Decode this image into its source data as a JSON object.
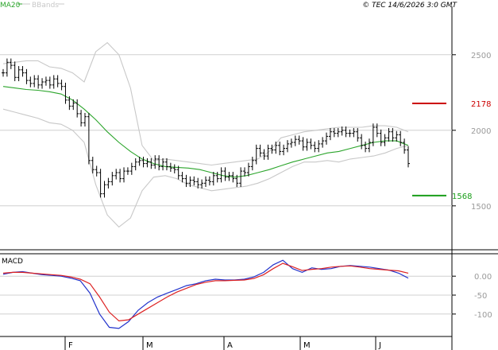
{
  "header": {
    "legend_ma": "MA20",
    "legend_bb": "BBands",
    "timestamp": "© TEC 14/6/2026 3:0 GMT"
  },
  "colors": {
    "ma": "#2ca52c",
    "bbands": "#c8c8c8",
    "price_bars": "#000000",
    "resistance": "#cc0000",
    "support": "#1a9e1a",
    "macd": "#2233cc",
    "signal": "#dd2222",
    "grid": "#d0d0d0",
    "axis_text": "#9a9a9a"
  },
  "chart_data": [
    {
      "type": "line",
      "title": "",
      "x": [
        "F",
        "M",
        "A",
        "M",
        "J"
      ],
      "ylim": [
        1220,
        2820
      ],
      "yticks": [
        "2500",
        "2000",
        "1500"
      ],
      "grid": true,
      "legend": [
        "MA20",
        "BBands"
      ],
      "levels": {
        "resistance": 2178,
        "support": 1568
      },
      "price_points": [
        2380,
        2450,
        2430,
        2350,
        2400,
        2380,
        2330,
        2310,
        2340,
        2300,
        2320,
        2330,
        2300,
        2340,
        2310,
        2290,
        2200,
        2160,
        2180,
        2110,
        2050,
        2090,
        1800,
        1740,
        1720,
        1580,
        1640,
        1660,
        1700,
        1720,
        1680,
        1730,
        1730,
        1760,
        1790,
        1800,
        1780,
        1790,
        1770,
        1810,
        1760,
        1790,
        1760,
        1750,
        1740,
        1700,
        1680,
        1650,
        1670,
        1660,
        1640,
        1650,
        1670,
        1660,
        1700,
        1680,
        1730,
        1690,
        1700,
        1680,
        1650,
        1730,
        1720,
        1760,
        1800,
        1880,
        1850,
        1830,
        1880,
        1870,
        1900,
        1860,
        1880,
        1910,
        1920,
        1940,
        1930,
        1890,
        1920,
        1900,
        1880,
        1910,
        1930,
        1960,
        1990,
        1980,
        1990,
        2000,
        1980,
        1980,
        1990,
        1950,
        1900,
        1880,
        1920,
        2020,
        1980,
        1920,
        1950,
        1990,
        1950,
        1970,
        1920,
        1870,
        1780
      ],
      "series": [
        {
          "name": "MA20",
          "values": [
            2290,
            2280,
            2270,
            2265,
            2255,
            2240,
            2200,
            2140,
            2070,
            1990,
            1920,
            1860,
            1810,
            1780,
            1760,
            1755,
            1750,
            1740,
            1720,
            1700,
            1690,
            1700,
            1720,
            1740,
            1765,
            1790,
            1810,
            1830,
            1850,
            1860,
            1880,
            1900,
            1920,
            1930,
            1930,
            1900
          ]
        },
        {
          "name": "BBands upper",
          "values": [
            2440,
            2450,
            2460,
            2460,
            2420,
            2410,
            2380,
            2320,
            2520,
            2580,
            2500,
            2280,
            1900,
            1800,
            1810,
            1800,
            1790,
            1780,
            1770,
            1780,
            1790,
            1800,
            1810,
            1860,
            1950,
            1970,
            1990,
            2000,
            2010,
            2020,
            2020,
            2020,
            2030,
            2030,
            2020,
            1990
          ]
        },
        {
          "name": "BBands lower",
          "values": [
            2140,
            2120,
            2100,
            2080,
            2050,
            2040,
            2000,
            1920,
            1640,
            1440,
            1360,
            1420,
            1600,
            1690,
            1700,
            1680,
            1640,
            1620,
            1600,
            1610,
            1620,
            1630,
            1650,
            1680,
            1720,
            1760,
            1790,
            1790,
            1800,
            1790,
            1810,
            1820,
            1830,
            1850,
            1880,
            1900
          ]
        }
      ]
    },
    {
      "type": "line",
      "title": "",
      "legend": [
        "MACD"
      ],
      "ylim": [
        -155,
        55
      ],
      "yticks": [
        "0.00",
        "-50",
        "-100"
      ],
      "grid": true,
      "series": [
        {
          "name": "MACD",
          "values": [
            5,
            10,
            12,
            8,
            4,
            2,
            0,
            -5,
            -12,
            -45,
            -100,
            -135,
            -138,
            -120,
            -90,
            -70,
            -55,
            -45,
            -35,
            -25,
            -20,
            -12,
            -8,
            -10,
            -10,
            -8,
            -2,
            10,
            30,
            42,
            20,
            10,
            22,
            18,
            20,
            26,
            28,
            26,
            24,
            20,
            16,
            8,
            -5
          ]
        },
        {
          "name": "MACD signal",
          "values": [
            8,
            10,
            10,
            8,
            6,
            4,
            2,
            -2,
            -8,
            -20,
            -55,
            -95,
            -118,
            -115,
            -100,
            -85,
            -70,
            -55,
            -42,
            -32,
            -22,
            -16,
            -12,
            -12,
            -11,
            -10,
            -6,
            4,
            20,
            34,
            25,
            15,
            18,
            20,
            24,
            26,
            27,
            24,
            20,
            18,
            16,
            14,
            8
          ]
        }
      ]
    }
  ]
}
